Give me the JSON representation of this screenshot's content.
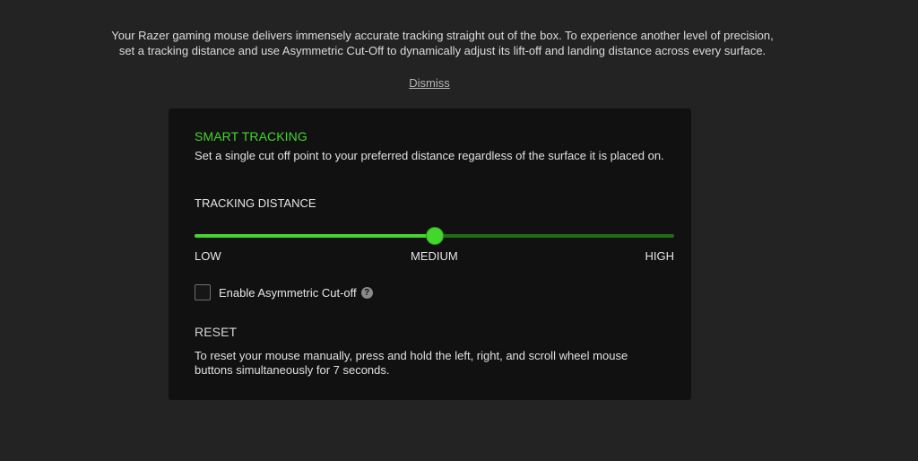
{
  "intro": {
    "line1": "Your Razer gaming mouse delivers immensely accurate tracking straight out of the box. To experience another level of precision,",
    "line2": "set a tracking distance and use Asymmetric Cut-Off to dynamically adjust its lift-off and landing distance across every surface."
  },
  "dismiss_label": "Dismiss",
  "smart_tracking": {
    "title": "SMART TRACKING",
    "description": "Set a single cut off point to your preferred distance regardless of the surface it is placed on.",
    "tracking_distance_label": "TRACKING DISTANCE",
    "slider": {
      "value_fraction": 0.5,
      "min_label": "LOW",
      "mid_label": "MEDIUM",
      "max_label": "HIGH"
    },
    "asymmetric": {
      "label": "Enable Asymmetric Cut-off",
      "checked": false,
      "help_icon": "question-circle-icon",
      "help_glyph": "?"
    }
  },
  "reset": {
    "title": "RESET",
    "description": "To reset your mouse manually, press and hold the left, right, and scroll wheel mouse buttons simultaneously for 7 seconds."
  },
  "colors": {
    "accent": "#44d62c",
    "accent_dark": "#1f6d15",
    "background": "#232323",
    "panel": "#111111"
  }
}
